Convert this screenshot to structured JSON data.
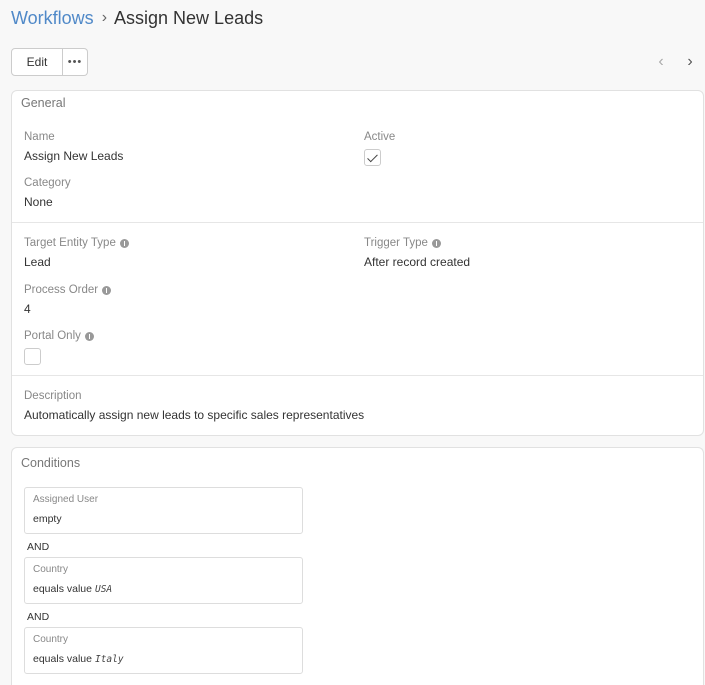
{
  "breadcrumb": {
    "parent": "Workflows",
    "separator": "›",
    "current": "Assign New Leads"
  },
  "toolbar": {
    "edit_label": "Edit",
    "more_label": "•••",
    "prev_icon": "‹",
    "next_icon": "›"
  },
  "general": {
    "title": "General",
    "name": {
      "label": "Name",
      "value": "Assign New Leads"
    },
    "active": {
      "label": "Active",
      "checked": true
    },
    "category": {
      "label": "Category",
      "value": "None"
    },
    "target_entity_type": {
      "label": "Target Entity Type",
      "value": "Lead"
    },
    "trigger_type": {
      "label": "Trigger Type",
      "value": "After record created"
    },
    "process_order": {
      "label": "Process Order",
      "value": "4"
    },
    "portal_only": {
      "label": "Portal Only",
      "checked": false
    },
    "description": {
      "label": "Description",
      "value": "Automatically assign new leads to specific sales representatives"
    }
  },
  "conditions": {
    "title": "Conditions",
    "items": [
      {
        "label": "Assigned User",
        "operator": "empty",
        "value": ""
      },
      {
        "label": "Country",
        "operator": "equals value",
        "value": "USA"
      },
      {
        "label": "Country",
        "operator": "equals value",
        "value": "Italy"
      }
    ],
    "joiners": [
      "AND",
      "AND"
    ]
  },
  "colors": {
    "link": "#5089c8",
    "border": "#e1e1e1",
    "background": "#f8f8f8"
  }
}
